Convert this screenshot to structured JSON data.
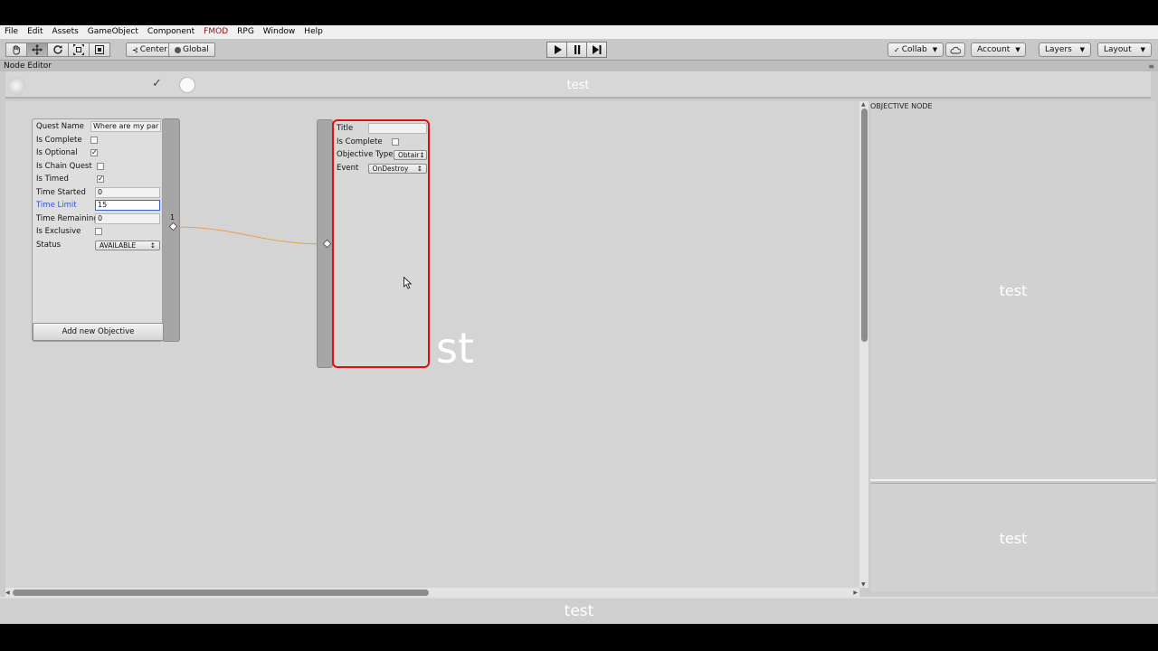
{
  "menu": [
    "File",
    "Edit",
    "Assets",
    "GameObject",
    "Component",
    "FMOD",
    "RPG",
    "Window",
    "Help"
  ],
  "toolbar": {
    "tools": [
      "hand-icon",
      "move-icon",
      "rotate-icon",
      "scale-icon",
      "rect-icon"
    ],
    "pivot_label": "Center",
    "space_label": "Global",
    "collab_label": "Collab",
    "account_label": "Account",
    "layers_label": "Layers",
    "layout_label": "Layout"
  },
  "editor": {
    "tab_label": "Node Editor",
    "header_title": "test",
    "footer_title": "test"
  },
  "quest_node": {
    "fields": {
      "quest_name": {
        "label": "Quest Name",
        "value": "Where are my par"
      },
      "is_complete": {
        "label": "Is Complete",
        "checked": false
      },
      "is_optional": {
        "label": "Is Optional",
        "checked": true
      },
      "is_chain_quest": {
        "label": "Is Chain Quest",
        "checked": false
      },
      "is_timed": {
        "label": "Is Timed",
        "checked": true
      },
      "time_started": {
        "label": "Time Started",
        "value": "0"
      },
      "time_limit": {
        "label": "Time Limit",
        "value": "15"
      },
      "time_remaining": {
        "label": "Time Remaining",
        "value": "0"
      },
      "is_exclusive": {
        "label": "Is Exclusive",
        "checked": false
      },
      "status": {
        "label": "Status",
        "value": "AVAILABLE"
      }
    },
    "port_number": "1",
    "add_button_label": "Add new Objective"
  },
  "objective_node": {
    "title_label": "Title",
    "title_value": "",
    "is_complete_label": "Is Complete",
    "objective_type_label": "Objective Type",
    "objective_type_value": "Obtair",
    "event_label": "Event",
    "event_value": "OnDestroy"
  },
  "canvas_overlay_text": "st",
  "right_panel": {
    "header": "OBJECTIVE NODE",
    "top_text": "test",
    "bottom_text": "test"
  },
  "colors": {
    "selection_border": "#e01010",
    "connection": "#e8a050",
    "focus_label": "#3355cc"
  }
}
